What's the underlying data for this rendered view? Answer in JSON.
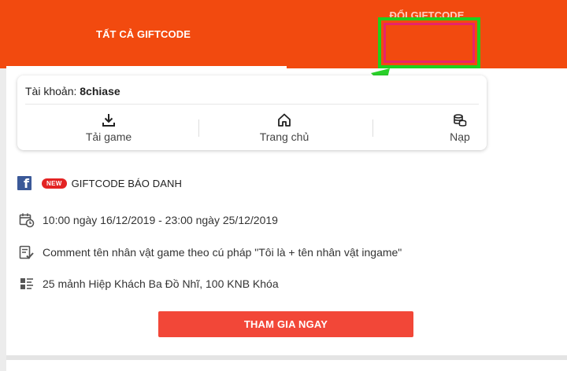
{
  "tabs": {
    "all_label": "TẤT CẢ GIFTCODE",
    "redeem_label": "ĐỔI GIFTCODE"
  },
  "account": {
    "prefix": "Tài khoản:",
    "username": "8chiase"
  },
  "quick_actions": [
    {
      "label": "Tải game",
      "icon": "download-icon"
    },
    {
      "label": "Trang chủ",
      "icon": "home-icon"
    },
    {
      "label": "Nạp",
      "icon": "coins-icon"
    }
  ],
  "giftcode": {
    "badge": "NEW",
    "title": "GIFTCODE BÁO DANH",
    "time": "10:00 ngày 16/12/2019 - 23:00 ngày 25/12/2019",
    "requirement": "Comment tên nhân vật game theo cú pháp \"Tôi là + tên nhân vật ingame\"",
    "reward": "25 mảnh Hiệp Khách Ba Đồ Nhĩ, 100 KNB Khóa",
    "join_label": "THAM GIA NGAY"
  },
  "colors": {
    "header": "#f24a0f",
    "join_button": "#f24738",
    "highlight_green": "#1ecf1e",
    "highlight_red": "#e8246a"
  }
}
